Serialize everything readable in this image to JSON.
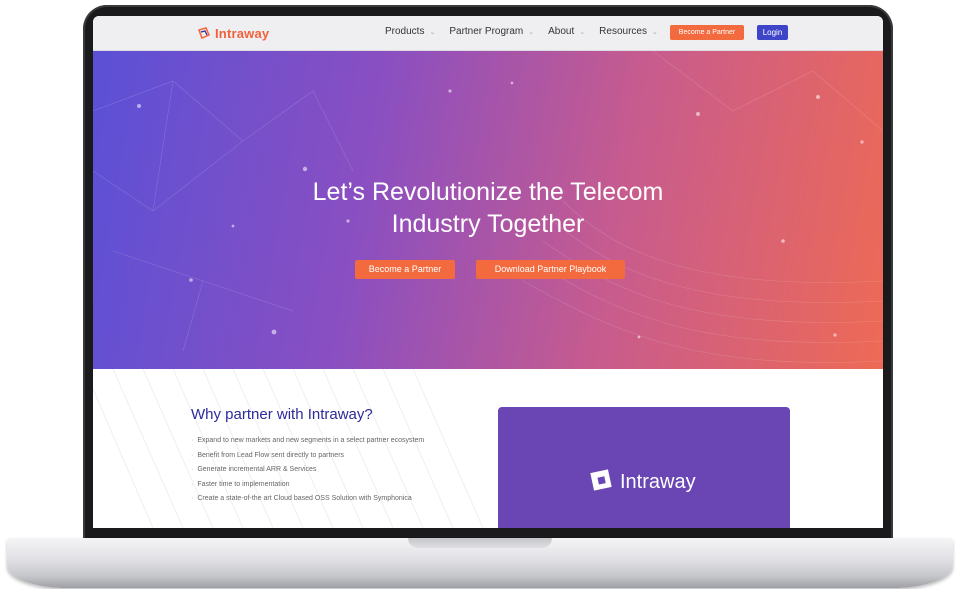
{
  "brand": {
    "name": "Intraway",
    "accent": "#f36a3e",
    "primary": "#3f45c8"
  },
  "nav": {
    "items": [
      {
        "label": "Products",
        "has_dropdown": true
      },
      {
        "label": "Partner Program",
        "has_dropdown": true
      },
      {
        "label": "About",
        "has_dropdown": true
      },
      {
        "label": "Resources",
        "has_dropdown": true
      }
    ],
    "become_partner": "Become a Partner",
    "login": "Login"
  },
  "hero": {
    "title_line1": "Let’s Revolutionize the Telecom",
    "title_line2": "Industry Together",
    "cta_primary": "Become a Partner",
    "cta_secondary": "Download Partner Playbook"
  },
  "why": {
    "title": "Why partner with Intraway?",
    "benefits": [
      "Expand to new markets and new segments in a select partner ecosystem",
      "Benefit from Lead Flow sent directly to partners",
      "Generate incremental ARR & Services",
      "Faster time to implementation",
      "Create a state-of-the art Cloud based OSS Solution with Symphonica"
    ],
    "card_brand": "Intraway"
  }
}
